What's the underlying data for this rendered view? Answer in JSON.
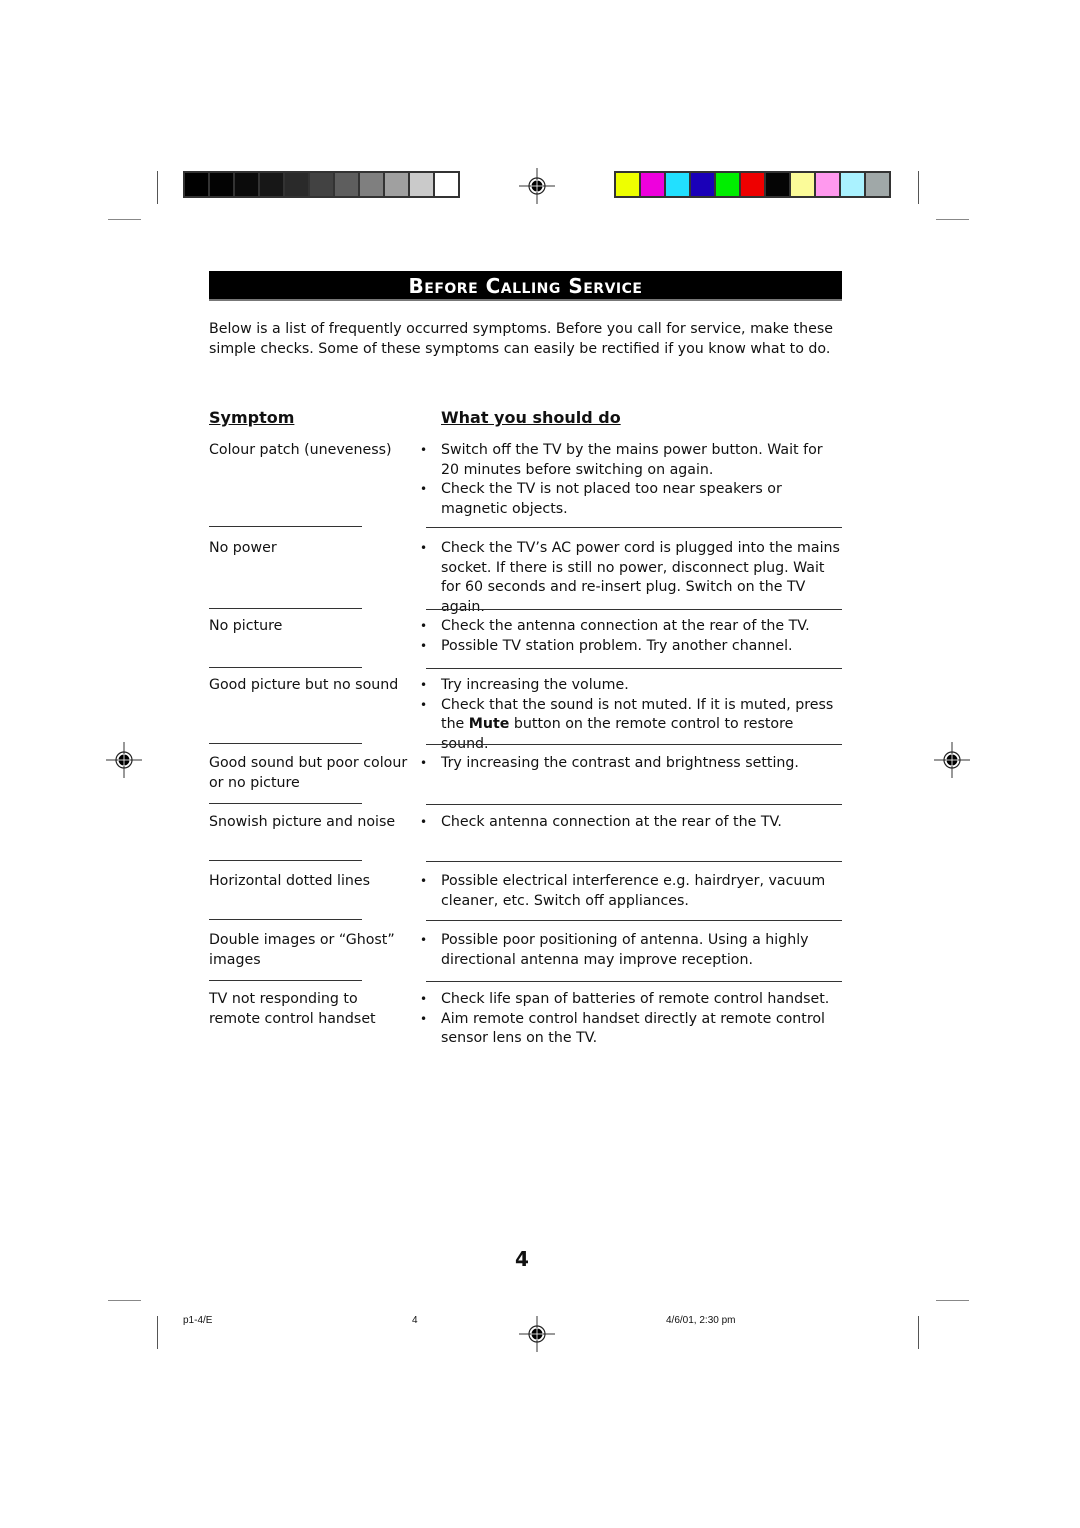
{
  "calibration": {
    "grayscale": [
      "#000000",
      "#030303",
      "#0b0b0b",
      "#171717",
      "#2a2a2a",
      "#424242",
      "#5e5e5e",
      "#7f7f7f",
      "#a0a0a0",
      "#cacaca",
      "#ffffff"
    ],
    "colors": [
      "#eeff00",
      "#ee00dd",
      "#22e0ff",
      "#1a00b8",
      "#00ee00",
      "#ee0000",
      "#050505",
      "#fbfb99",
      "#ff99ee",
      "#aaf2ff",
      "#a0a8a8"
    ]
  },
  "header": {
    "title": "Before Calling Service"
  },
  "intro": "Below is a list of frequently occurred symptoms. Before you call for service, make these simple checks. Some of these symptoms can easily be rectified if you know what to do.",
  "columns": {
    "symptom": "Symptom",
    "action": "What you should do"
  },
  "rows": [
    {
      "symptom": "Colour patch (uneveness)",
      "actions": [
        "Switch off the TV by the mains power button. Wait for 20 minutes before switching on again.",
        "Check the TV is not placed too near speakers or magnetic objects."
      ]
    },
    {
      "symptom": "No power",
      "actions": [
        "Check the TV’s AC power cord is plugged into the mains socket. If there is still no power, disconnect plug. Wait for 60 seconds and re-insert plug. Switch on the TV again."
      ]
    },
    {
      "symptom": "No picture",
      "actions": [
        "Check the antenna connection at the rear of the TV.",
        "Possible TV station problem. Try another channel."
      ]
    },
    {
      "symptom": "Good picture but no sound",
      "actions": [
        "Try increasing the volume.",
        "Check that the sound is not muted. If it is muted, press the Mute button on the remote control to restore sound."
      ]
    },
    {
      "symptom": "Good sound but poor colour or no picture",
      "actions": [
        "Try increasing the contrast and brightness setting."
      ]
    },
    {
      "symptom": "Snowish picture and noise",
      "actions": [
        "Check antenna connection at the rear of the TV."
      ]
    },
    {
      "symptom": "Horizontal dotted lines",
      "actions": [
        "Possible electrical interference e.g. hairdryer, vacuum cleaner, etc. Switch off appliances."
      ]
    },
    {
      "symptom": "Double images or “Ghost” images",
      "actions": [
        "Possible poor positioning of antenna. Using a highly directional  antenna may improve reception."
      ]
    },
    {
      "symptom": "TV not responding to remote control handset",
      "actions": [
        "Check life span of batteries of remote control handset.",
        "Aim remote control handset directly at remote control sensor lens on the TV."
      ]
    }
  ],
  "page_number": "4",
  "footer": {
    "file": "p1-4/E",
    "page": "4",
    "timestamp": "4/6/01, 2:30 pm"
  }
}
